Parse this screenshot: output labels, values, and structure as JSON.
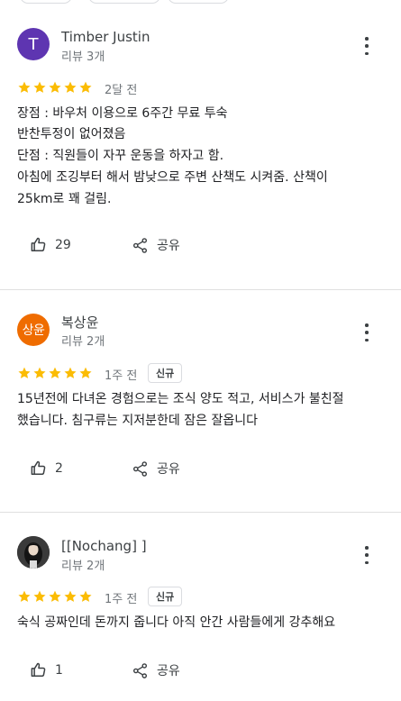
{
  "reviews": [
    {
      "avatar_text": "T",
      "name": "Timber Justin",
      "review_count": "리뷰 3개",
      "rating": 5,
      "date": "2달 전",
      "lines": [
        "장점 : 바우처 이용으로 6주간 무료 투숙",
        "반찬투정이 없어졌음",
        "단점 : 직원들이 자꾸 운동을 하자고 함.",
        "아침에 조깅부터 해서 밤낮으로 주변 산책도 시켜줌. 산책이",
        "25km로 꽤 걸림."
      ],
      "likes": "29",
      "share_label": "공유"
    },
    {
      "avatar_text": "상윤",
      "name": "복상윤",
      "review_count": "리뷰 2개",
      "rating": 5,
      "date": "1주 전",
      "badge": "신규",
      "lines": [
        "15년전에 다녀온 경험으로는 조식 양도 적고, 서비스가 불친절",
        "했습니다. 침구류는 지저분한데 잠은 잘옵니다"
      ],
      "likes": "2",
      "share_label": "공유"
    },
    {
      "name": "[[Nochang] ]",
      "review_count": "리뷰 2개",
      "rating": 5,
      "date": "1주 전",
      "badge": "신규",
      "lines": [
        "숙식 공짜인데 돈까지 줍니다 아직 안간 사람들에게 강추해요"
      ],
      "likes": "1",
      "share_label": "공유"
    }
  ],
  "colors": {
    "star": "#fbbc04",
    "avatar_t": "#5e35b1",
    "avatar_k": "#ef6c00",
    "divider": "#e0e0e0"
  },
  "icons": {
    "like": "thumb-up-icon",
    "share": "share-icon",
    "more": "more-vert-icon",
    "star": "star-icon"
  }
}
